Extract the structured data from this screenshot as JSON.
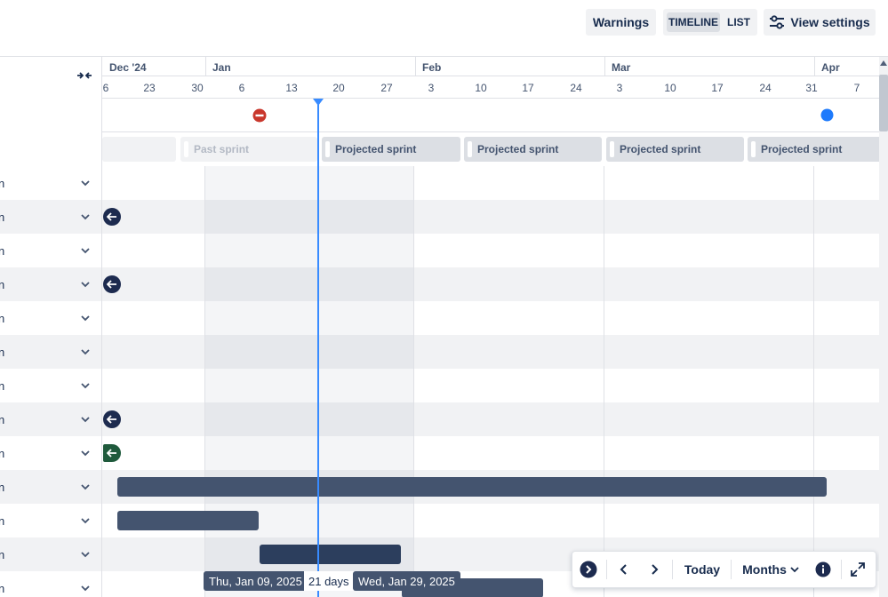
{
  "toolbar": {
    "warnings_label": "Warnings",
    "timeline_label": "TIMELINE",
    "list_label": "LIST",
    "view_settings_label": "View settings"
  },
  "timeline": {
    "months": [
      "Dec '24",
      "Jan",
      "Feb",
      "Mar",
      "Apr"
    ],
    "days": [
      "6",
      "23",
      "30",
      "6",
      "13",
      "20",
      "27",
      "3",
      "10",
      "17",
      "24",
      "3",
      "10",
      "17",
      "24",
      "31",
      "7"
    ]
  },
  "sprints": [
    {
      "label": ""
    },
    {
      "label": "Past sprint"
    },
    {
      "label": "Projected sprint"
    },
    {
      "label": "Projected sprint"
    },
    {
      "label": "Projected sprint"
    },
    {
      "label": "Projected sprint"
    }
  ],
  "rows": [
    {
      "text": "n"
    },
    {
      "text": "n"
    },
    {
      "text": "n"
    },
    {
      "text": "n"
    },
    {
      "text": "n"
    },
    {
      "text": "n"
    },
    {
      "text": "n"
    },
    {
      "text": "n"
    },
    {
      "text": "n"
    },
    {
      "text": "n"
    },
    {
      "text": "n"
    },
    {
      "text": "n"
    },
    {
      "text": "n"
    }
  ],
  "selection": {
    "start_label": "Thu, Jan 09, 2025",
    "duration_label": "21 days",
    "end_label": "Wed, Jan 29, 2025"
  },
  "bottombar": {
    "today_label": "Today",
    "months_label": "Months"
  },
  "colors": {
    "accent": "#388bff",
    "bar": "#44546f",
    "error": "#c9372c",
    "marker": "#1d7afc"
  }
}
